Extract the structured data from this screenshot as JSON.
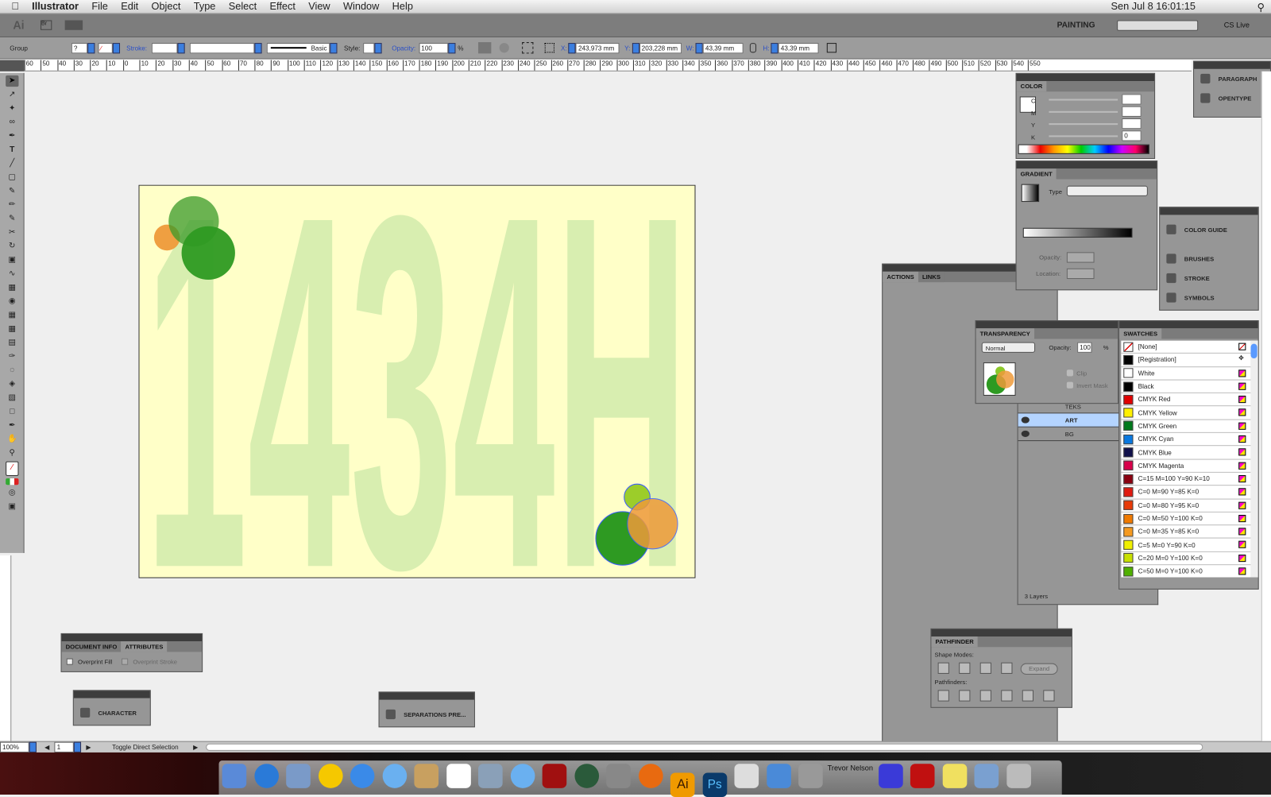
{
  "menubar": {
    "app": "Illustrator",
    "items": [
      "File",
      "Edit",
      "Object",
      "Type",
      "Select",
      "Effect",
      "View",
      "Window",
      "Help"
    ],
    "clock": "Sen Jul 8  16:01:15"
  },
  "appbar": {
    "workspace": "PAINTING",
    "cslive": "CS Live"
  },
  "control": {
    "selection": "Group",
    "stroke_label": "Stroke:",
    "stroke_style": "Basic",
    "style_label": "Style:",
    "opacity_label": "Opacity:",
    "opacity": "100",
    "pct": "%",
    "x_label": "X:",
    "x": "243,973 mm",
    "y_label": "Y:",
    "y": "203,228 mm",
    "w_label": "W:",
    "w": "43,39 mm",
    "h_label": "H:",
    "h": "43,39 mm"
  },
  "ruler": [
    "60",
    "50",
    "40",
    "30",
    "20",
    "10",
    "0",
    "10",
    "20",
    "30",
    "40",
    "50",
    "60",
    "70",
    "80",
    "90",
    "100",
    "110",
    "120",
    "130",
    "140",
    "150",
    "160",
    "170",
    "180",
    "190",
    "200",
    "210",
    "220",
    "230",
    "240",
    "250",
    "260",
    "270",
    "280",
    "290",
    "300",
    "310",
    "320",
    "330",
    "340",
    "350",
    "360",
    "370",
    "380",
    "390",
    "400",
    "410",
    "420",
    "430",
    "440",
    "450",
    "460",
    "470",
    "480",
    "490",
    "500",
    "510",
    "520",
    "530",
    "540",
    "550"
  ],
  "artwork": {
    "text": "1434H",
    "bg": "#ffffc8",
    "letter_color": "#d8eeb0"
  },
  "color_panel": {
    "title": "COLOR",
    "channels": [
      "C",
      "M",
      "Y",
      "K"
    ],
    "k_value": "0",
    "pct": "%"
  },
  "gradient_panel": {
    "title": "GRADIENT",
    "type_label": "Type",
    "opacity_label": "Opacity:",
    "location_label": "Location:",
    "pct": "%"
  },
  "right_dock": {
    "top": [
      "PARAGRAPH",
      "OPENTYPE"
    ],
    "mid": [
      "COLOR GUIDE",
      "BRUSHES",
      "STROKE",
      "SYMBOLS"
    ]
  },
  "actions_panel": {
    "tabs": [
      "ACTIONS",
      "LINKS"
    ]
  },
  "layers": {
    "rows": [
      "TEKS",
      "ART",
      "BG"
    ],
    "count": "3 Layers"
  },
  "transparency": {
    "title": "TRANSPARENCY",
    "mode": "Normal",
    "opacity_label": "Opacity:",
    "opacity": "100",
    "pct": "%",
    "clip": "Clip",
    "invert": "Invert Mask"
  },
  "swatches": {
    "title": "SWATCHES",
    "items": [
      {
        "name": "[None]",
        "color": "#ffffff"
      },
      {
        "name": "[Registration]",
        "color": "#000000"
      },
      {
        "name": "White",
        "color": "#ffffff"
      },
      {
        "name": "Black",
        "color": "#000000"
      },
      {
        "name": "CMYK Red",
        "color": "#e00000"
      },
      {
        "name": "CMYK Yellow",
        "color": "#fff000"
      },
      {
        "name": "CMYK Green",
        "color": "#007a1c"
      },
      {
        "name": "CMYK Cyan",
        "color": "#0a78e0"
      },
      {
        "name": "CMYK Blue",
        "color": "#10104a"
      },
      {
        "name": "CMYK Magenta",
        "color": "#d8004a"
      },
      {
        "name": "C=15 M=100 Y=90 K=10",
        "color": "#8a0010"
      },
      {
        "name": "C=0 M=90 Y=85 K=0",
        "color": "#e01a10"
      },
      {
        "name": "C=0 M=80 Y=95 K=0",
        "color": "#e83a08"
      },
      {
        "name": "C=0 M=50 Y=100 K=0",
        "color": "#f07a00"
      },
      {
        "name": "C=0 M=35 Y=85 K=0",
        "color": "#f59a20"
      },
      {
        "name": "C=5 M=0 Y=90 K=0",
        "color": "#f0f000"
      },
      {
        "name": "C=20 M=0 Y=100 K=0",
        "color": "#c8e000"
      },
      {
        "name": "C=50 M=0 Y=100 K=0",
        "color": "#50b000"
      }
    ]
  },
  "pathfinder": {
    "title": "PATHFINDER",
    "shape_modes": "Shape Modes:",
    "pathfinders": "Pathfinders:",
    "expand": "Expand"
  },
  "docinfo": {
    "tabs": [
      "DOCUMENT INFO",
      "ATTRIBUTES"
    ],
    "overprint_fill": "Overprint Fill",
    "overprint_stroke": "Overprint Stroke"
  },
  "character": {
    "label": "CHARACTER"
  },
  "separations": {
    "label": "SEPARATIONS PRE..."
  },
  "status": {
    "zoom": "100%",
    "page": "1",
    "tool": "Toggle Direct Selection"
  },
  "dock": {
    "user": "Trevor Nelson"
  }
}
